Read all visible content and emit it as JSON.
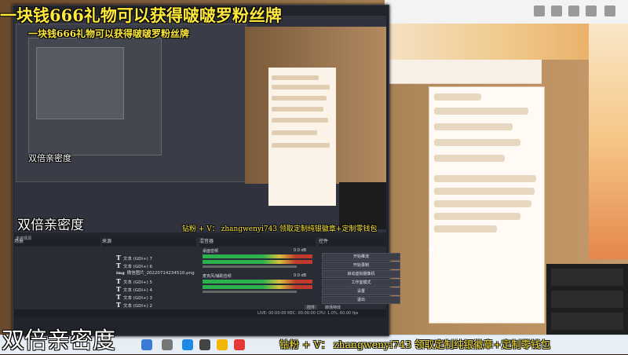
{
  "overlay": {
    "title_top": "一块钱666礼物可以获得啵啵罗粉丝牌",
    "title_nested": "一块钱666礼物可以获得啵啵罗粉丝牌",
    "caption_left": "双倍亲密度",
    "caption_mid": "双倍亲密度",
    "caption_small": "双倍亲密度",
    "promo_bottom": "钻粉 + V： zhangwenyi743 领取定制纯银徽章+定制零钱包",
    "promo_mid": "钻粉 + V： zhangwenyi743 领取定制纯银徽章+定制零钱包"
  },
  "obs": {
    "docks": {
      "scenes": "场景",
      "sources": "来源",
      "mixer": "混音器",
      "controls": "控件",
      "selected_hint": "未选择源"
    },
    "sources": [
      {
        "icon": "T",
        "name": "文本 (GDI+) 7"
      },
      {
        "icon": "T",
        "name": "文本 (GDI+) 6"
      },
      {
        "icon": "img",
        "name": "微信图片_20220714234510.png"
      },
      {
        "icon": "T",
        "name": "文本 (GDI+) 5"
      },
      {
        "icon": "T",
        "name": "文本 (GDI+) 4"
      },
      {
        "icon": "T",
        "name": "文本 (GDI+) 3"
      },
      {
        "icon": "T",
        "name": "文本 (GDI+) 2"
      }
    ],
    "mixer": {
      "track1": "桌面音频",
      "track1_db": "0.0 dB",
      "track2": "麦克风/辅助音频",
      "track2_db": "0.0 dB"
    },
    "controls": [
      "开始推流",
      "开始录制",
      "启动虚拟摄像机",
      "工作室模式",
      "设置",
      "退出"
    ],
    "bottom_tabs": [
      "控件",
      "转场特效"
    ],
    "status": "LIVE: 00:00:00   REC: 00:00:00   CPU: 1.0%, 60.00 fps"
  },
  "colors": {
    "title_yellow": "#ffe93a",
    "meter_green": "#2bb24c",
    "meter_yellow": "#d8c13a",
    "meter_red": "#c0392b",
    "obs_bg": "#22242c"
  }
}
